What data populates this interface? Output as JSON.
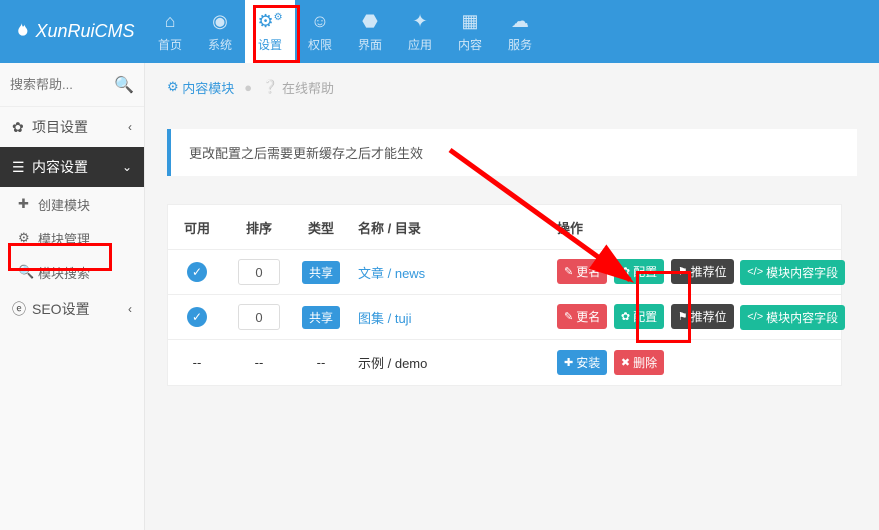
{
  "logo": "XunRuiCMS",
  "topnav": [
    {
      "label": "首页",
      "icon": "home"
    },
    {
      "label": "系统",
      "icon": "globe"
    },
    {
      "label": "设置",
      "icon": "cogs"
    },
    {
      "label": "权限",
      "icon": "user"
    },
    {
      "label": "界面",
      "icon": "html5"
    },
    {
      "label": "应用",
      "icon": "puzzle"
    },
    {
      "label": "内容",
      "icon": "grid"
    },
    {
      "label": "服务",
      "icon": "cloud"
    }
  ],
  "topnav_active": 2,
  "search": {
    "placeholder": "搜索帮助..."
  },
  "sidebar": [
    {
      "label": "项目设置",
      "icon": "gear",
      "open": false,
      "kids": []
    },
    {
      "label": "内容设置",
      "icon": "bars",
      "open": true,
      "kids": [
        {
          "label": "创建模块",
          "icon": "plus"
        },
        {
          "label": "模块管理",
          "icon": "cogs",
          "hl": true
        },
        {
          "label": "模块搜索",
          "icon": "search"
        }
      ]
    },
    {
      "label": "SEO设置",
      "icon": "ie",
      "open": false,
      "kids": []
    }
  ],
  "crumb": {
    "module": "内容模块",
    "help": "在线帮助"
  },
  "alert": "更改配置之后需要更新缓存之后才能生效",
  "table": {
    "headers": {
      "use": "可用",
      "sort": "排序",
      "type": "类型",
      "name": "名称 / 目录",
      "ops": "操作"
    },
    "rows": [
      {
        "enabled": true,
        "sort": "0",
        "type": "共享",
        "name": "文章 / news",
        "ops": [
          "rename",
          "config",
          "recpos",
          "fields"
        ]
      },
      {
        "enabled": true,
        "sort": "0",
        "type": "共享",
        "name": "图集 / tuji",
        "ops": [
          "rename",
          "config",
          "recpos",
          "fields"
        ]
      },
      {
        "enabled": false,
        "sort": "--",
        "type": "--",
        "name": "示例 / demo",
        "ops": [
          "install",
          "delete"
        ]
      }
    ]
  },
  "btns": {
    "rename": "更名",
    "config": "配置",
    "recpos": "推荐位",
    "fields": "模块内容字段",
    "install": "安装",
    "delete": "删除"
  }
}
